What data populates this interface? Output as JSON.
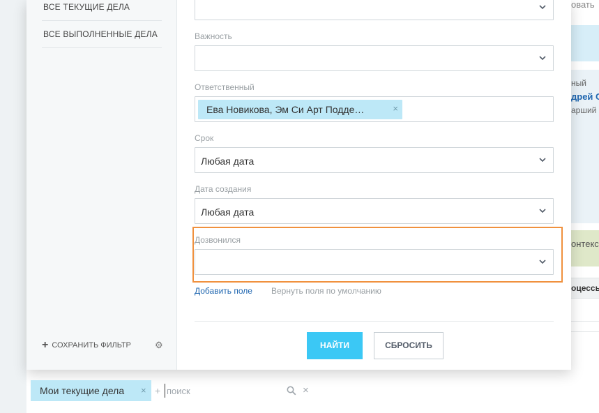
{
  "background": {
    "top_text": "овать",
    "info_line1": "ный",
    "info_line2": "дрей О",
    "info_line3": "арший",
    "green_text": "онтекст",
    "grey_text": "оцессы"
  },
  "presets": [
    {
      "label": "Все текущие дела"
    },
    {
      "label": "Все выполненные дела"
    }
  ],
  "save_filter_label": "Сохранить фильтр",
  "fields": {
    "importance_label": "Важность",
    "responsible_label": "Ответственный",
    "responsible_tag": "Ева Новикова, Эм Си Арт Подде…",
    "deadline_label": "Срок",
    "deadline_value": "Любая дата",
    "created_label": "Дата создания",
    "created_value": "Любая дата",
    "called_label": "Дозвонился"
  },
  "links": {
    "add_field": "Добавить поле",
    "reset_fields": "Вернуть поля по умолчанию"
  },
  "buttons": {
    "find": "Найти",
    "reset": "Сбросить"
  },
  "search": {
    "active_filter": "Мои текущие дела",
    "placeholder": "поиск"
  },
  "icons": {
    "remove": "×",
    "plus": "+",
    "gear": "⚙"
  }
}
